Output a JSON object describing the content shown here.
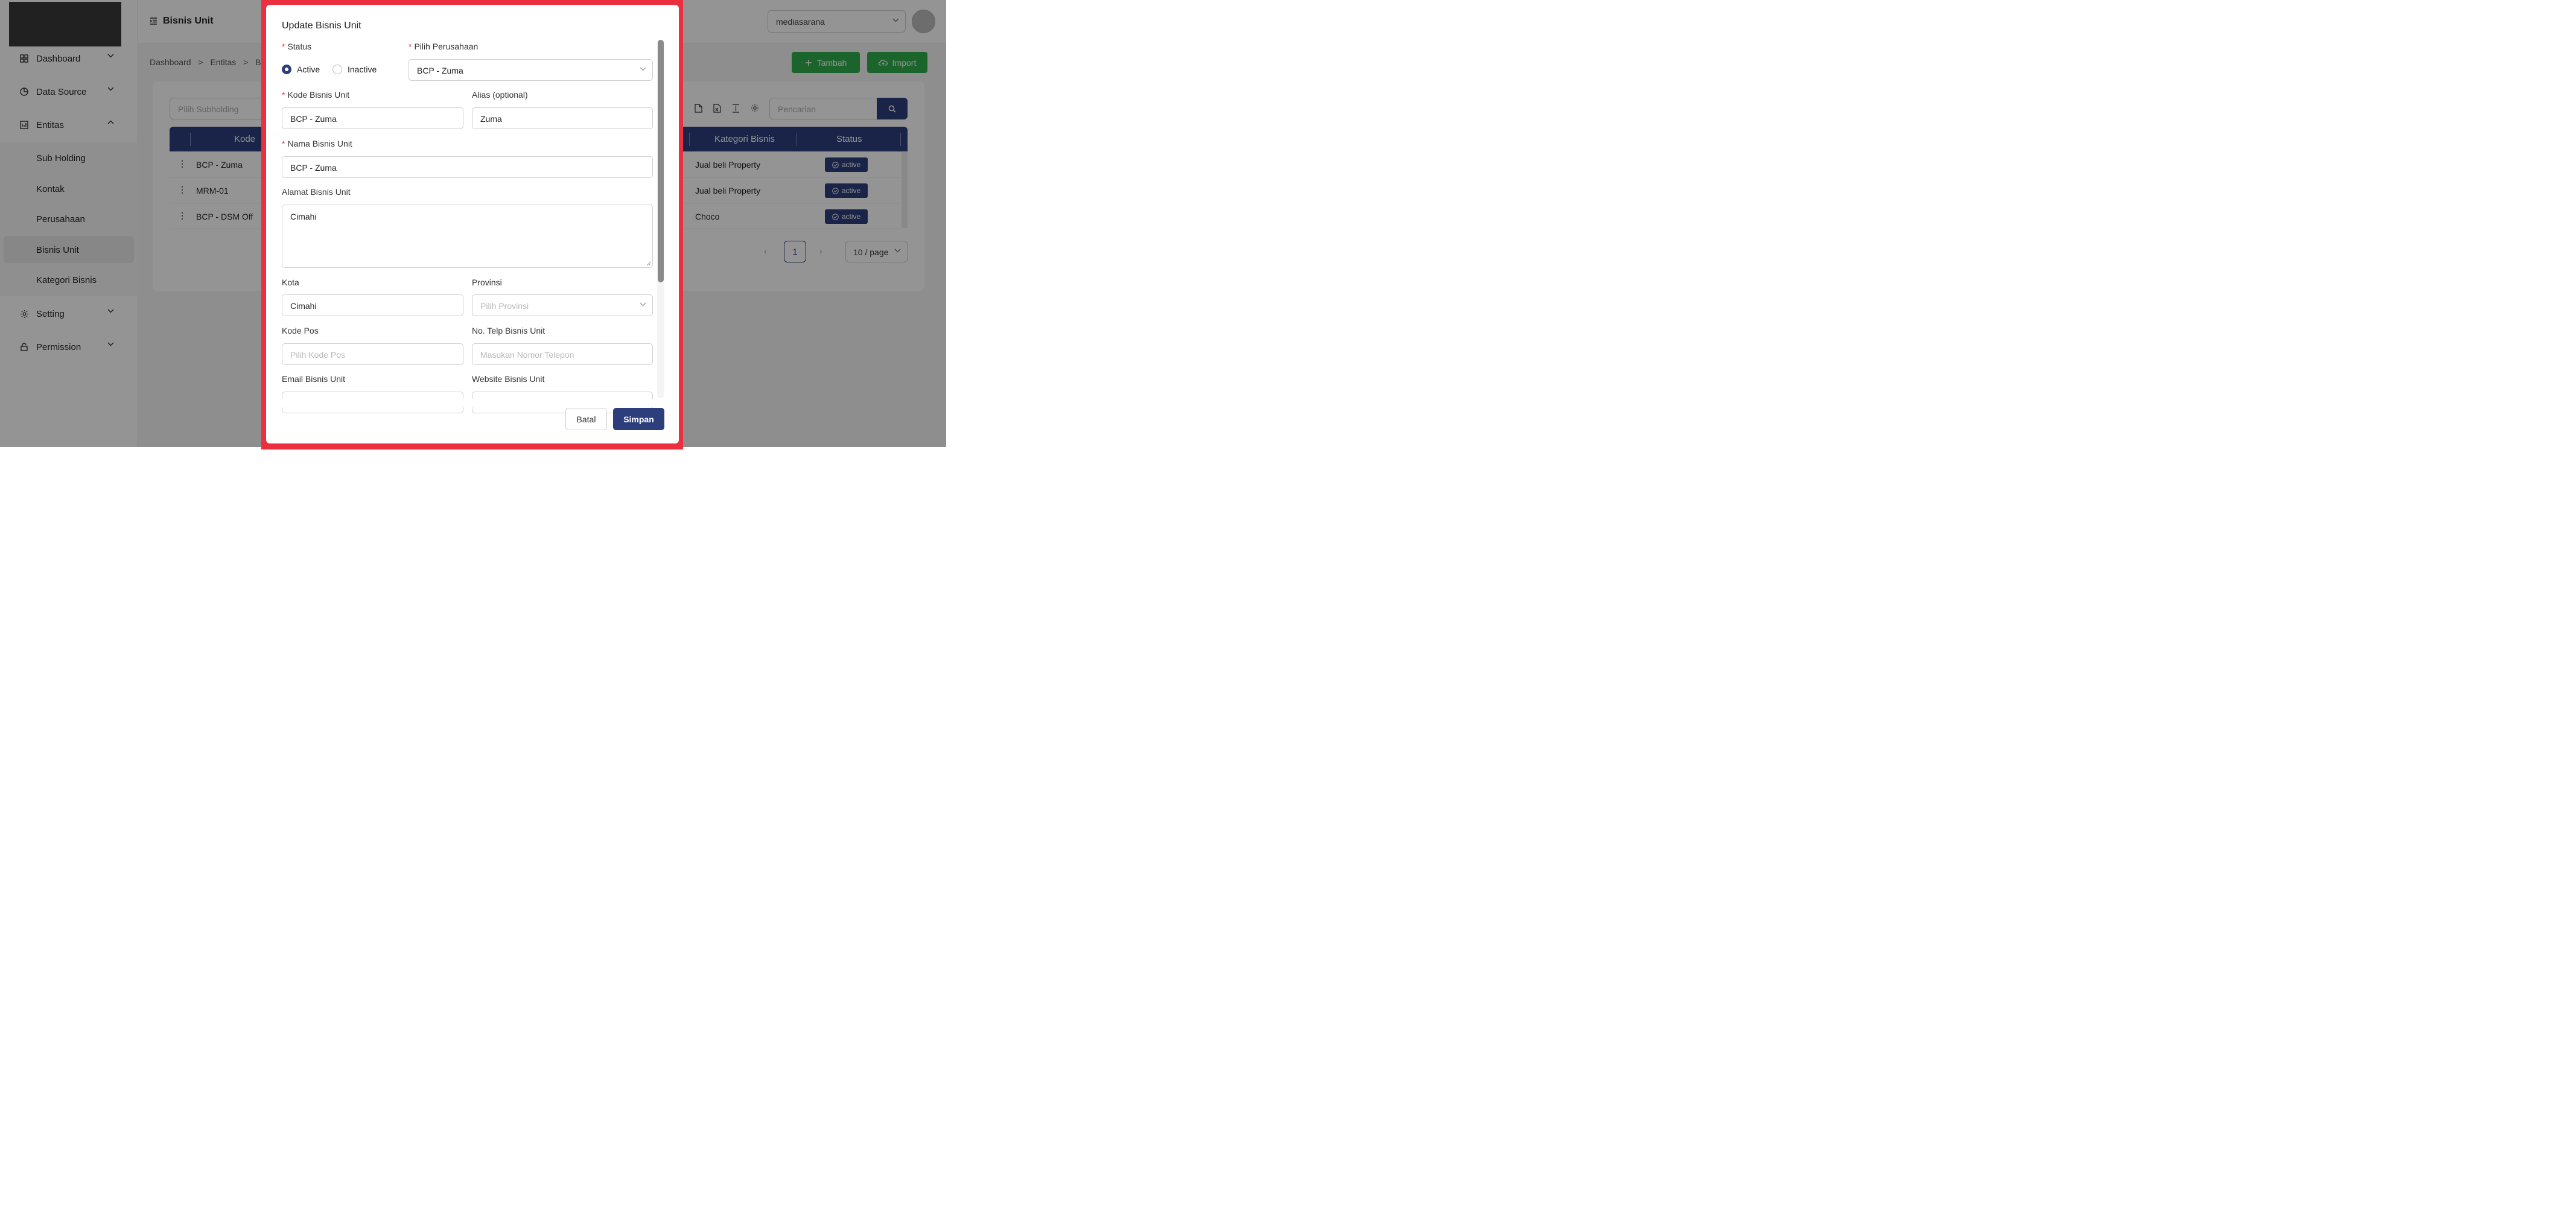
{
  "header": {
    "page_title": "Bisnis Unit",
    "org_select": "mediasarana"
  },
  "sidebar": {
    "items": [
      {
        "label": "Dashboard",
        "icon": "dashboard-grid-icon"
      },
      {
        "label": "Data Source",
        "icon": "pie-chart-icon"
      },
      {
        "label": "Entitas",
        "icon": "building-icon"
      },
      {
        "label": "Setting",
        "icon": "gear-icon"
      },
      {
        "label": "Permission",
        "icon": "lock-icon"
      }
    ],
    "sub_items": [
      "Sub Holding",
      "Kontak",
      "Perusahaan",
      "Bisnis Unit",
      "Kategori Bisnis"
    ],
    "active_sub_item": "Bisnis Unit"
  },
  "breadcrumb": {
    "items": [
      "Dashboard",
      "Entitas",
      "Bi"
    ],
    "separator": ">"
  },
  "toolbar": {
    "add_label": "Tambah",
    "import_label": "Import",
    "filter_placeholder": "Pilih Subholding",
    "search_placeholder": "Pencarian"
  },
  "table": {
    "columns": [
      "Kode",
      "Kategori Bisnis",
      "Status"
    ],
    "rows": [
      {
        "code": "BCP - Zuma",
        "category": "Jual beli Property",
        "status": "active"
      },
      {
        "code": "MRM-01",
        "category": "Jual beli Property",
        "status": "active"
      },
      {
        "code": "BCP - DSM Off",
        "category": "Choco",
        "status": "active"
      }
    ]
  },
  "pagination": {
    "current_page": "1",
    "page_size": "10 / page"
  },
  "modal": {
    "title": "Update Bisnis Unit",
    "status_label": "Status",
    "status_options": [
      "Active",
      "Inactive"
    ],
    "status_selected": "Active",
    "company_label": "Pilih Perusahaan",
    "company_value": "BCP - Zuma",
    "code_label": "Kode Bisnis Unit",
    "code_value": "BCP - Zuma",
    "alias_label": "Alias (optional)",
    "alias_value": "Zuma",
    "name_label": "Nama Bisnis Unit",
    "name_value": "BCP - Zuma",
    "address_label": "Alamat Bisnis Unit",
    "address_value": "Cimahi",
    "city_label": "Kota",
    "city_value": "Cimahi",
    "province_label": "Provinsi",
    "province_placeholder": "Pilih Provinsi",
    "postal_label": "Kode Pos",
    "postal_placeholder": "Pilih Kode Pos",
    "phone_label": "No. Telp Bisnis Unit",
    "phone_placeholder": "Masukan Nomor Telepon",
    "email_label": "Email Bisnis Unit",
    "website_label": "Website Bisnis Unit",
    "cancel_label": "Batal",
    "save_label": "Simpan"
  },
  "colors": {
    "primary": "#2c3e7c",
    "success": "#2fae4f",
    "required": "#e02a3a",
    "highlight_frame": "#ec2f3f"
  }
}
